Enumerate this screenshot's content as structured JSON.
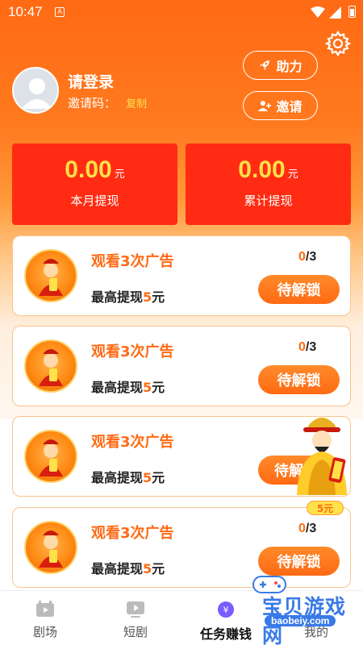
{
  "status_bar": {
    "time": "10:47",
    "a_badge": "A"
  },
  "profile": {
    "login_label": "请登录",
    "invite_code_label": "邀请码：",
    "copy_label": "复制"
  },
  "header_buttons": {
    "boost_label": "助力",
    "invite_label": "邀请"
  },
  "stats": [
    {
      "value": "0.00",
      "unit": "元",
      "label": "本月提现"
    },
    {
      "value": "0.00",
      "unit": "元",
      "label": "累计提现"
    }
  ],
  "tasks": [
    {
      "title_pre": "观看",
      "title_num": "3",
      "title_post": "次广告",
      "reward_pre": "最高提现",
      "reward_num": "5",
      "reward_post": "元",
      "progress_done": "0",
      "progress_total": "/3",
      "button": "待解锁"
    },
    {
      "title_pre": "观看",
      "title_num": "3",
      "title_post": "次广告",
      "reward_pre": "最高提现",
      "reward_num": "5",
      "reward_post": "元",
      "progress_done": "0",
      "progress_total": "/3",
      "button": "待解锁"
    },
    {
      "title_pre": "观看",
      "title_num": "3",
      "title_post": "次广告",
      "reward_pre": "最高提现",
      "reward_num": "5",
      "reward_post": "元",
      "progress_done": "",
      "progress_total": "",
      "button": "待解"
    },
    {
      "title_pre": "观看",
      "title_num": "3",
      "title_post": "次广告",
      "reward_pre": "最高提现",
      "reward_num": "5",
      "reward_post": "元",
      "progress_done": "0",
      "progress_total": "/3",
      "button": "待解锁"
    }
  ],
  "floating_reward": {
    "badge": "5元"
  },
  "bottom_nav": [
    {
      "label": "剧场",
      "active": false
    },
    {
      "label": "短剧",
      "active": false
    },
    {
      "label": "任务赚钱",
      "active": true
    },
    {
      "label": "我的",
      "active": false
    }
  ],
  "watermark": {
    "text": "宝贝游戏网",
    "url": "baobeiy.com"
  },
  "colors": {
    "accent": "#ff6a14",
    "card_red": "#ff2b12",
    "gold": "#ffe14a"
  }
}
